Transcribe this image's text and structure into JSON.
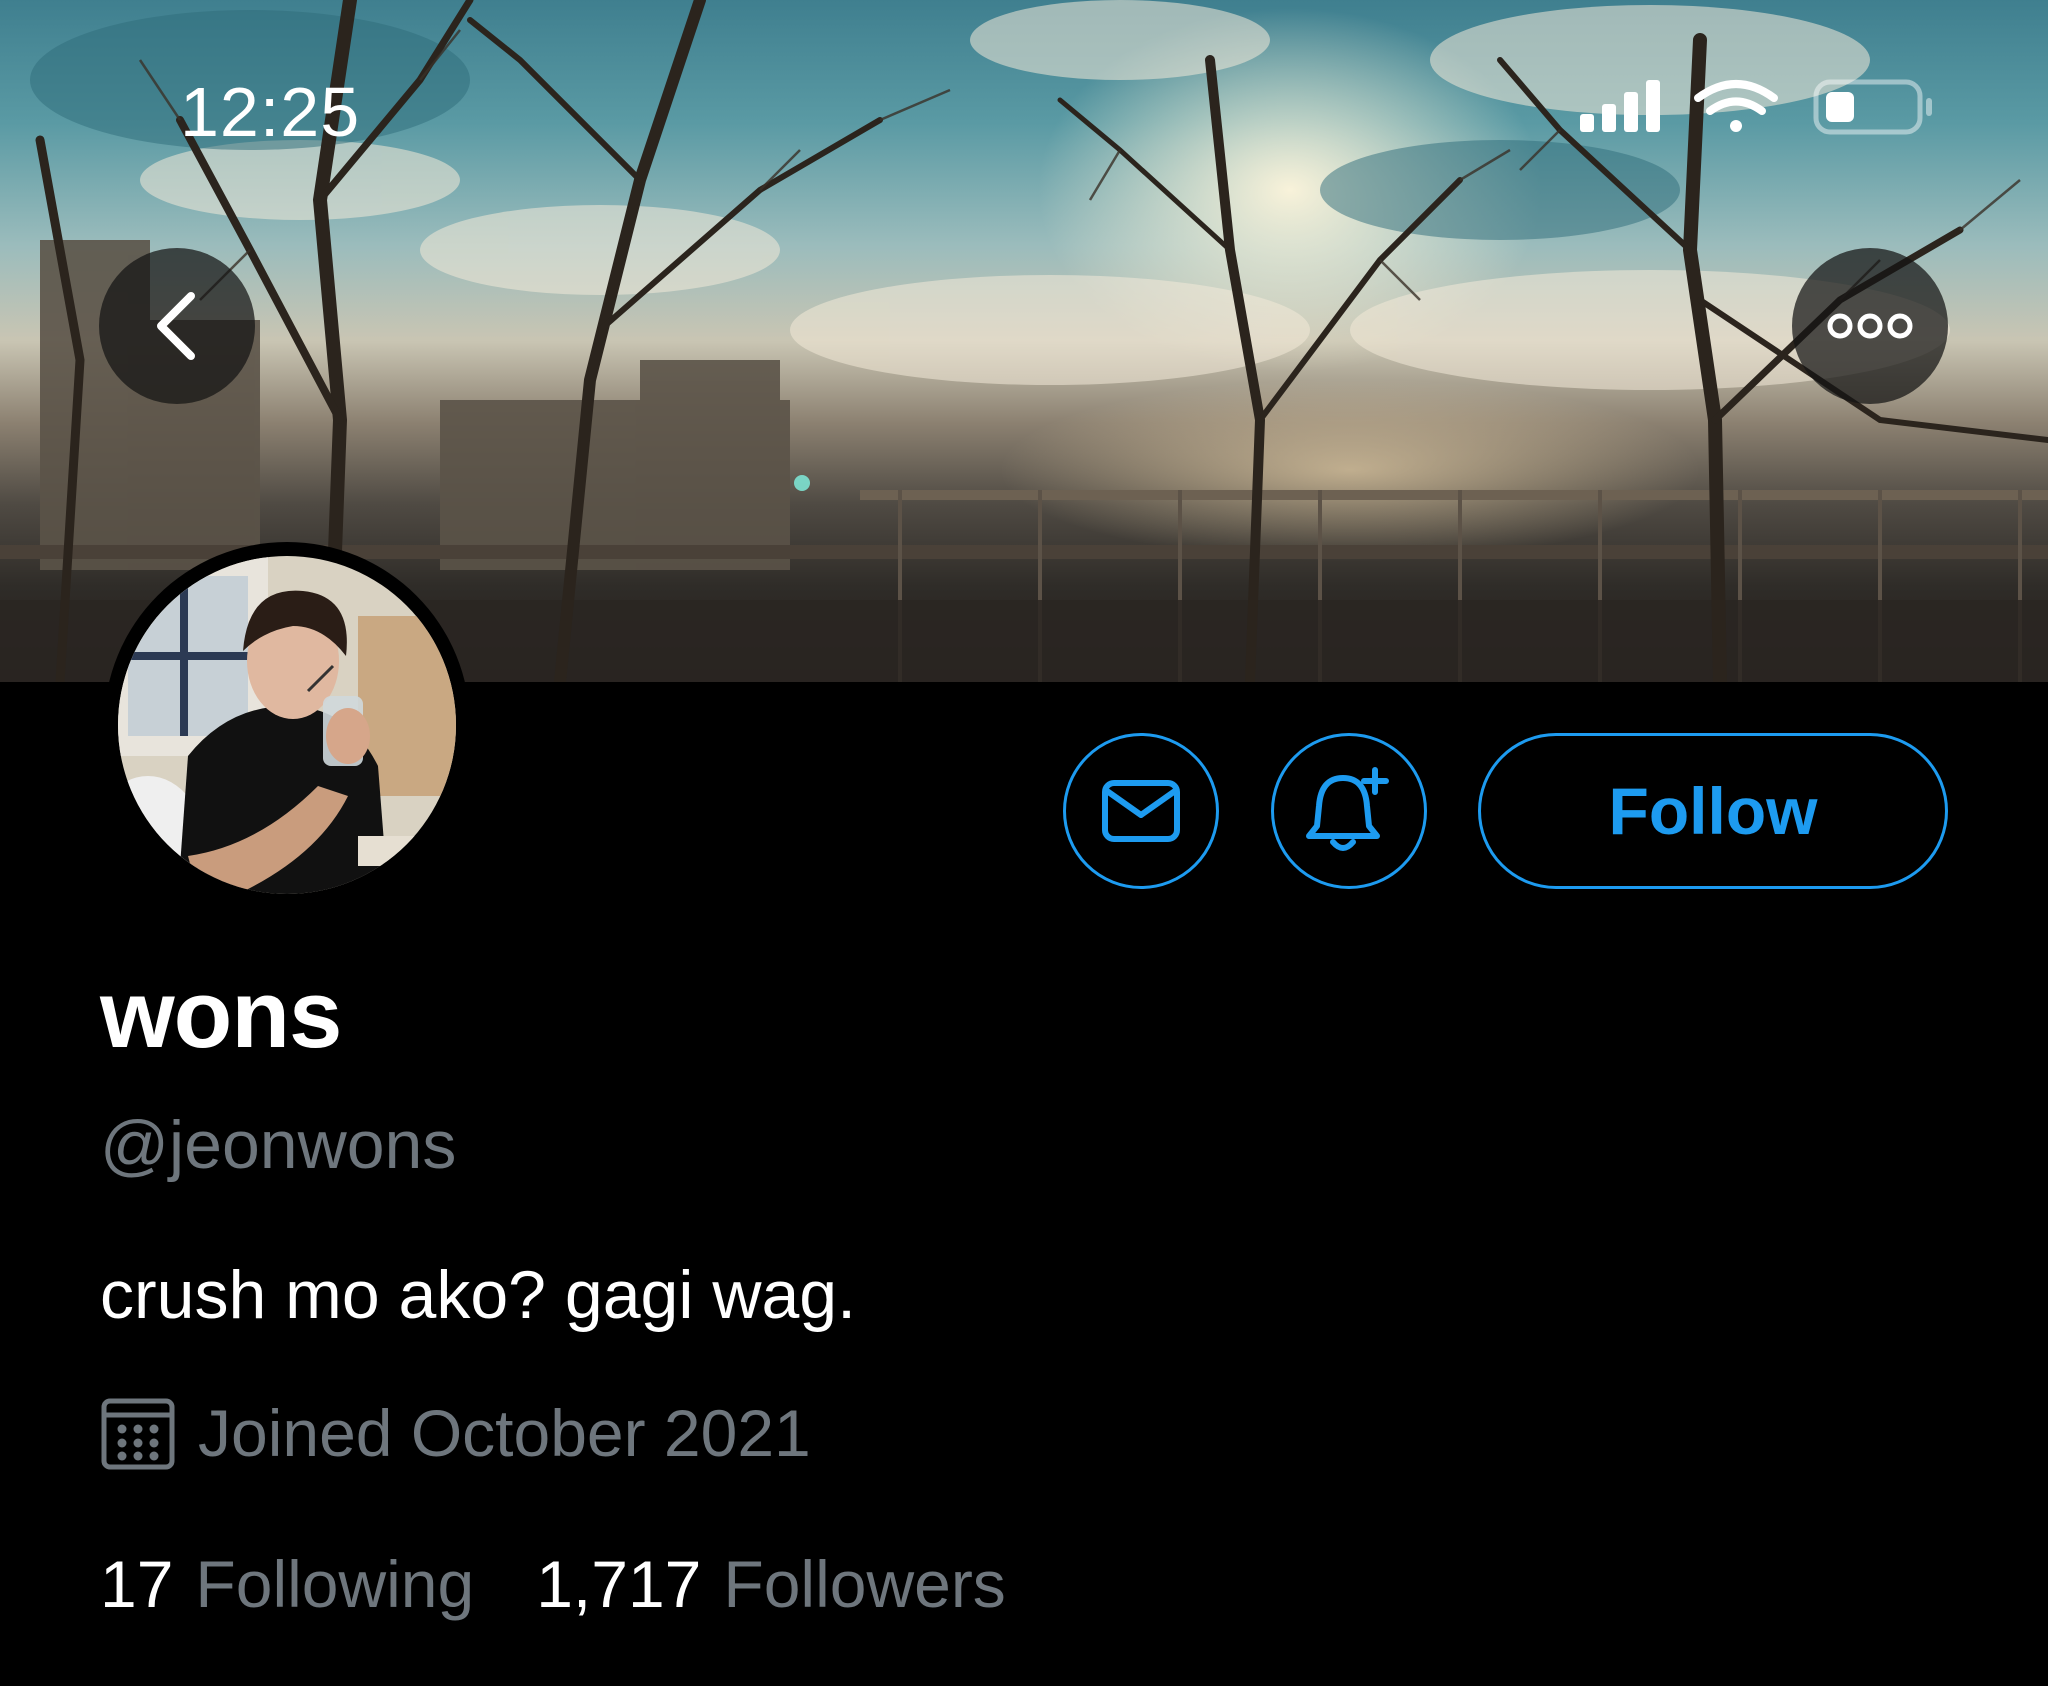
{
  "status_bar": {
    "time": "12:25",
    "icons": [
      "signal-icon",
      "wifi-icon",
      "battery-icon"
    ]
  },
  "nav": {
    "back_icon": "chevron-left-icon",
    "more_icon": "more-dots-icon"
  },
  "actions": {
    "message_icon": "envelope-icon",
    "notify_icon": "bell-plus-icon",
    "follow_label": "Follow"
  },
  "profile": {
    "display_name": "wons",
    "handle": "@jeonwons",
    "bio": "crush mo ako? gagi wag.",
    "joined": "Joined October 2021",
    "following_count": "17",
    "following_label": "Following",
    "followers_count": "1,717",
    "followers_label": "Followers"
  },
  "colors": {
    "accent": "#1d9bf0",
    "background": "#000000",
    "secondary_text": "#6e767d",
    "primary_text": "#ffffff"
  }
}
